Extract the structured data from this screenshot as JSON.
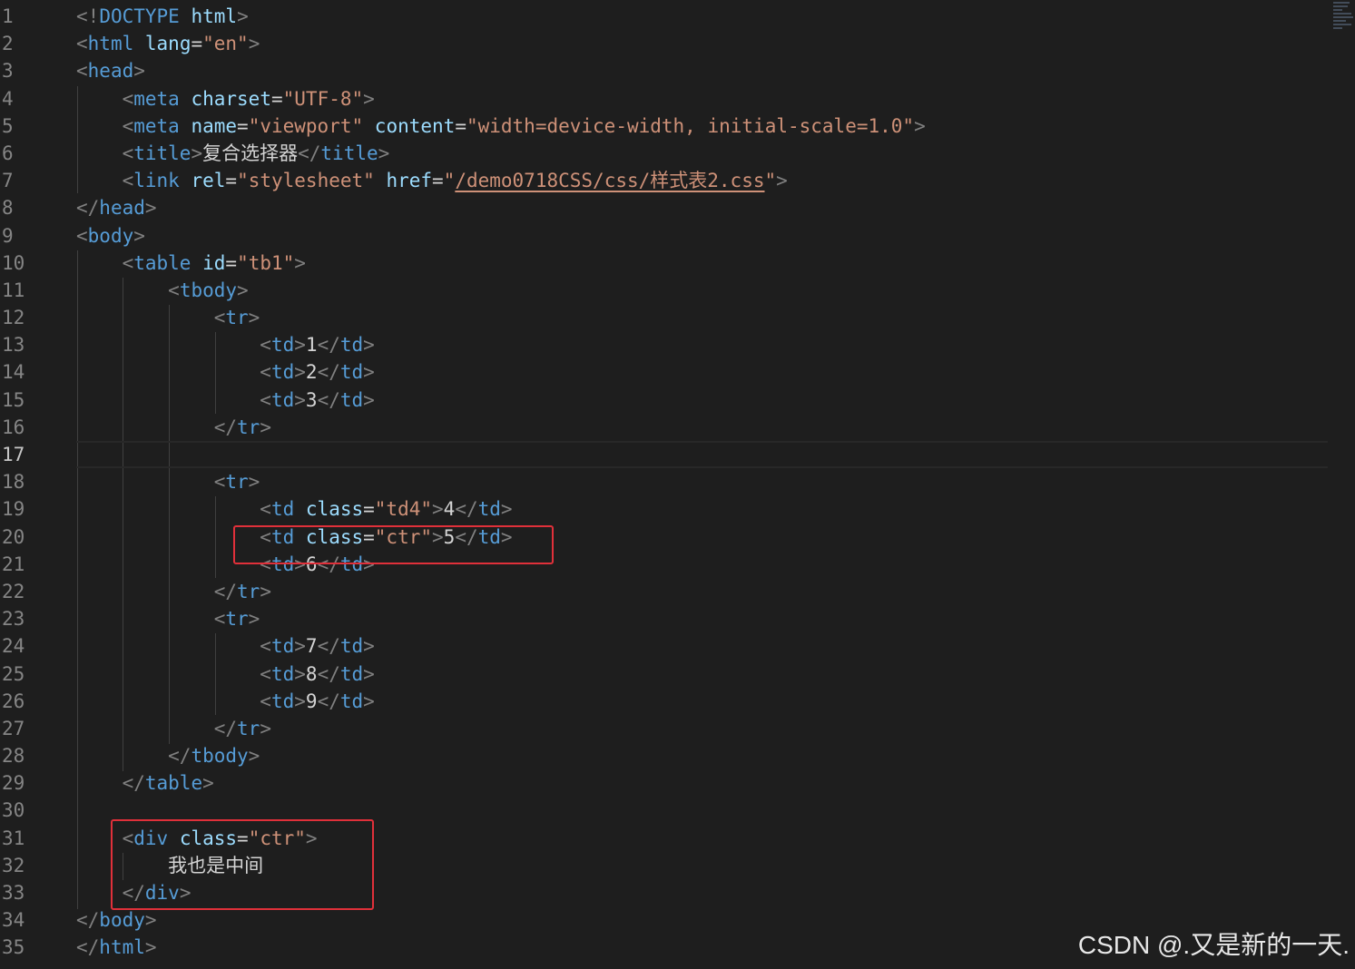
{
  "editor": {
    "line_numbers": [
      "1",
      "2",
      "3",
      "4",
      "5",
      "6",
      "7",
      "8",
      "9",
      "10",
      "11",
      "12",
      "13",
      "14",
      "15",
      "16",
      "17",
      "18",
      "19",
      "20",
      "21",
      "22",
      "23",
      "24",
      "25",
      "26",
      "27",
      "28",
      "29",
      "30",
      "31",
      "32",
      "33",
      "34",
      "35"
    ],
    "active_line": "17",
    "code": {
      "l1": {
        "open": "<!",
        "doctype": "DOCTYPE",
        "html": "html",
        "close": ">"
      },
      "l2": {
        "tag": "html",
        "attr": "lang",
        "val": "\"en\""
      },
      "l3": {
        "tag": "head"
      },
      "l4": {
        "tag": "meta",
        "attr": "charset",
        "val": "\"UTF-8\""
      },
      "l5": {
        "tag": "meta",
        "attr1": "name",
        "val1": "\"viewport\"",
        "attr2": "content",
        "val2": "\"width=device-width, initial-scale=1.0\""
      },
      "l6": {
        "tag": "title",
        "text": "复合选择器"
      },
      "l7": {
        "tag": "link",
        "attr1": "rel",
        "val1": "\"stylesheet\"",
        "attr2": "href",
        "q": "\"",
        "path": "/demo0718CSS/css/样式表2.css"
      },
      "l8": {
        "tag": "head"
      },
      "l9": {
        "tag": "body"
      },
      "l10": {
        "tag": "table",
        "attr": "id",
        "val": "\"tb1\""
      },
      "l11": {
        "tag": "tbody"
      },
      "l12": {
        "tag": "tr"
      },
      "l13": {
        "tag": "td",
        "text": "1"
      },
      "l14": {
        "tag": "td",
        "text": "2"
      },
      "l15": {
        "tag": "td",
        "text": "3"
      },
      "l16": {
        "tag": "tr"
      },
      "l18": {
        "tag": "tr"
      },
      "l19": {
        "tag": "td",
        "attr": "class",
        "val": "\"td4\"",
        "text": "4"
      },
      "l20": {
        "tag": "td",
        "attr": "class",
        "val": "\"ctr\"",
        "text": "5"
      },
      "l21": {
        "tag": "td",
        "text": "6"
      },
      "l22": {
        "tag": "tr"
      },
      "l23": {
        "tag": "tr"
      },
      "l24": {
        "tag": "td",
        "text": "7"
      },
      "l25": {
        "tag": "td",
        "text": "8"
      },
      "l26": {
        "tag": "td",
        "text": "9"
      },
      "l27": {
        "tag": "tr"
      },
      "l28": {
        "tag": "tbody"
      },
      "l29": {
        "tag": "table"
      },
      "l31": {
        "tag": "div",
        "attr": "class",
        "val": "\"ctr\""
      },
      "l32": {
        "text": "我也是中间"
      },
      "l33": {
        "tag": "div"
      },
      "l34": {
        "tag": "body"
      },
      "l35": {
        "tag": "html"
      }
    }
  },
  "watermark": "CSDN @.又是新的一天.",
  "colors": {
    "background": "#1e1e1e",
    "tag": "#569cd6",
    "attribute": "#9cdcfe",
    "string": "#ce9178",
    "punctuation": "#808080",
    "highlight_box": "#e0303a"
  }
}
